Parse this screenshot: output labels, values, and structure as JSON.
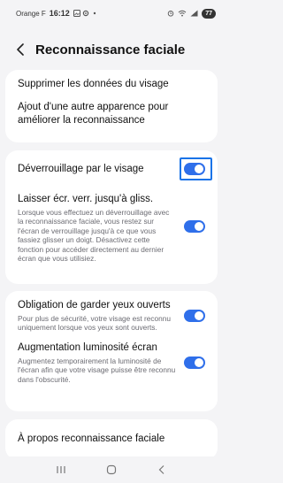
{
  "status_bar": {
    "carrier": "Orange F",
    "time": "16:12",
    "battery": "77"
  },
  "header": {
    "title": "Reconnaissance faciale"
  },
  "section1": {
    "delete_label": "Supprimer les données du visage",
    "add_appearance_label": "Ajout d'une autre apparence pour améliorer la reconnaissance"
  },
  "section2": {
    "unlock_label": "Déverrouillage par le visage",
    "unlock_on": true,
    "stay_label": "Laisser écr. verr. jusqu'à gliss.",
    "stay_desc": "Lorsque vous effectuez un déverrouillage avec la reconnaissance faciale, vous restez sur l'écran de verrouillage jusqu'à ce que vous fassiez glisser un doigt. Désactivez cette fonction pour accéder directement au dernier écran que vous utilisiez.",
    "stay_on": true
  },
  "section3": {
    "eyes_label": "Obligation de garder yeux ouverts",
    "eyes_desc": "Pour plus de sécurité, votre visage est reconnu uniquement lorsque vos yeux sont ouverts.",
    "eyes_on": true,
    "brightness_label": "Augmentation luminosité écran",
    "brightness_desc": "Augmentez temporairement la luminosité de l'écran afin que votre visage puisse être reconnu dans l'obscurité.",
    "brightness_on": true
  },
  "section4": {
    "about_label": "À propos reconnaissance faciale"
  },
  "colors": {
    "accent": "#2f6fea",
    "highlight": "#1a73e8",
    "background": "#f4f4f6"
  }
}
